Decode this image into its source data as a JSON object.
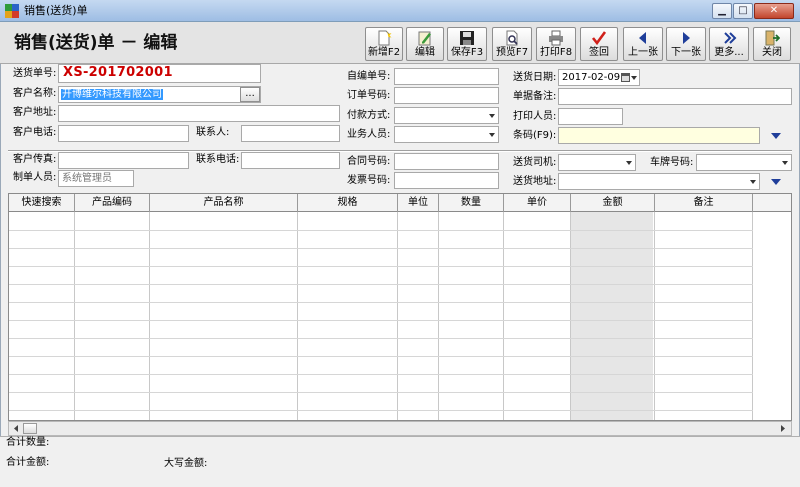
{
  "window": {
    "title": "销售(送货)单",
    "min": "▁",
    "max": "□",
    "close": "✕"
  },
  "header": {
    "title": "销售(送货)单 － 编辑"
  },
  "toolbar": [
    {
      "key": "new",
      "label": "新增F2",
      "icon": "new-document-icon"
    },
    {
      "key": "edit",
      "label": "编辑",
      "icon": "edit-icon"
    },
    {
      "key": "save",
      "label": "保存F3",
      "icon": "floppy-disk-icon"
    },
    {
      "key": "preview",
      "label": "预览F7",
      "icon": "preview-icon"
    },
    {
      "key": "print",
      "label": "打印F8",
      "icon": "printer-icon"
    },
    {
      "key": "approve",
      "label": "签回",
      "icon": "checkmark-icon"
    },
    {
      "key": "prev",
      "label": "上一张",
      "icon": "arrow-left-icon"
    },
    {
      "key": "next",
      "label": "下一张",
      "icon": "arrow-right-icon"
    },
    {
      "key": "more",
      "label": "更多...",
      "icon": "more-icon"
    },
    {
      "key": "close",
      "label": "关闭",
      "icon": "exit-icon"
    }
  ],
  "form": {
    "order_no_label": "送货单号:",
    "order_no": "XS-201702001",
    "customer_name_label": "客户名称:",
    "customer_name": "开博维尔科技有限公司",
    "customer_pick": "...",
    "customer_address_label": "客户地址:",
    "customer_address": "",
    "customer_phone_label": "客户电话:",
    "customer_phone": "",
    "contact_label": "联系人:",
    "contact": "",
    "own_no_label": "自编单号:",
    "own_no": "",
    "ref_no_label": "订单号码:",
    "ref_no": "",
    "payment_label": "付款方式:",
    "payment": "",
    "salesman_label": "业务人员:",
    "salesman": "",
    "date_label": "送货日期:",
    "date": "2017-02-09",
    "remark_label": "单据备注:",
    "remark": "",
    "printer_label": "打印人员:",
    "printer": "",
    "barcode_label": "条码(F9):",
    "barcode": "",
    "fax_label": "客户传真:",
    "fax": "",
    "contact_phone_label": "联系电话:",
    "contact_phone": "",
    "maker_label": "制单人员:",
    "maker": "系统管理员",
    "contract_label": "合同号码:",
    "contract": "",
    "invoice_label": "发票号码:",
    "invoice": "",
    "driver_label": "送货司机:",
    "driver": "",
    "plate_label": "车牌号码:",
    "plate": "",
    "address2_label": "送货地址:",
    "address2": ""
  },
  "grid": {
    "columns": [
      "快速搜索",
      "产品编码",
      "产品名称",
      "规格",
      "单位",
      "数量",
      "单价",
      "金额",
      "备注"
    ]
  },
  "footer": {
    "total_qty_label": "合计数量:",
    "total_qty": "",
    "total_amount_label": "合计金额:",
    "total_amount": "",
    "amount_words_label": "大写金额:",
    "amount_words": ""
  },
  "colors": {
    "accent": "#1f3e9a",
    "order_no": "#cc0000",
    "selection": "#3399ff",
    "barcode_bg": "#ffffe0"
  }
}
